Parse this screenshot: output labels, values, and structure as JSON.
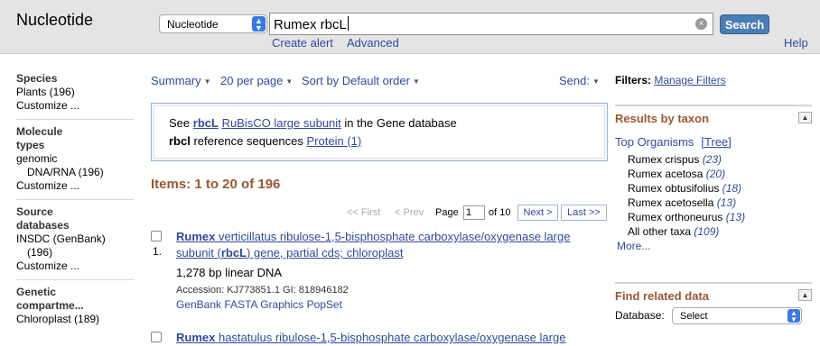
{
  "header": {
    "db_title": "Nucleotide",
    "db_select": "Nucleotide",
    "query": "Rumex rbcL",
    "search_button": "Search",
    "create_alert": "Create alert",
    "advanced": "Advanced",
    "help": "Help"
  },
  "facets": {
    "species_head": "Species",
    "species_item": "Plants (196)",
    "species_customize": "Customize ...",
    "mol_head_1": "Molecule",
    "mol_head_2": "types",
    "mol_item_1": "genomic",
    "mol_item_2": "DNA/RNA (196)",
    "mol_customize": "Customize ...",
    "src_head_1": "Source",
    "src_head_2": "databases",
    "src_item_1": "INSDC (GenBank)",
    "src_item_2": "(196)",
    "src_customize": "Customize ...",
    "gen_head_1": "Genetic",
    "gen_head_2": "compartme...",
    "gen_item": "Chloroplast (189)"
  },
  "toolbar": {
    "summary": "Summary",
    "per_page": "20 per page",
    "sort": "Sort by Default order",
    "send": "Send:"
  },
  "gene_box": {
    "see": "See",
    "gene": "rbcL",
    "gene_desc": "RuBisCO large subunit",
    "in_db": "in the Gene database",
    "refseq_gene": "rbcl",
    "refseq_text": "reference sequences",
    "protein": "Protein (1)"
  },
  "items_count": "Items: 1 to 20 of 196",
  "pager": {
    "first": "<< First",
    "prev": "< Prev",
    "page_label": "Page",
    "page_value": "1",
    "of": "of 10",
    "next": "Next >",
    "last": "Last >>"
  },
  "results": [
    {
      "num": "1.",
      "title_bold": "Rumex",
      "title_1": " verticillatus ribulose-1,5-bisphosphate carboxylase/oxygenase large",
      "title_2a": "subunit (",
      "title_2b": "rbcL",
      "title_2c": ") gene, partial cds; chloroplast",
      "desc": "1,278 bp linear DNA",
      "accession": "Accession: KJ773851.1   GI: 818946182",
      "links": [
        "GenBank",
        "FASTA",
        "Graphics",
        "PopSet"
      ]
    },
    {
      "title_bold": "Rumex",
      "title_1": " hastatulus ribulose-1,5-bisphosphate carboxylase/oxygenase large"
    }
  ],
  "right": {
    "filters_label": "Filters:",
    "manage_filters": "Manage Filters",
    "taxon_title": "Results by taxon",
    "top_organisms": "Top Organisms",
    "tree": "[Tree]",
    "taxa": [
      {
        "name": "Rumex crispus",
        "count": "(23)"
      },
      {
        "name": "Rumex acetosa",
        "count": "(20)"
      },
      {
        "name": "Rumex obtusifolius",
        "count": "(18)"
      },
      {
        "name": "Rumex acetosella",
        "count": "(13)"
      },
      {
        "name": "Rumex orthoneurus",
        "count": "(13)"
      },
      {
        "name": "All other taxa",
        "count": "(109)"
      }
    ],
    "more": "More...",
    "related_title": "Find related data",
    "database_label": "Database:",
    "database_select": "Select"
  },
  "colors": {
    "link": "#2f4a9e",
    "heading_brown": "#985735",
    "search_button": "#4a7eb5",
    "select_chevron": "#3b78e7"
  }
}
